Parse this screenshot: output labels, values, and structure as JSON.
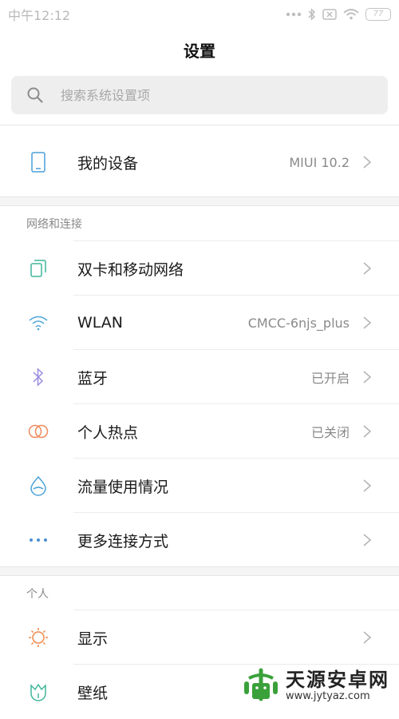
{
  "status_bar": {
    "time": "中午12:12",
    "battery": "77"
  },
  "header": {
    "title": "设置"
  },
  "search": {
    "placeholder": "搜索系统设置项"
  },
  "top_items": [
    {
      "label": "我的设备",
      "value": "MIUI 10.2",
      "icon": "phone-icon"
    }
  ],
  "sections": [
    {
      "title": "网络和连接",
      "items": [
        {
          "label": "双卡和移动网络",
          "value": "",
          "icon": "sim-card-icon"
        },
        {
          "label": "WLAN",
          "value": "CMCC-6njs_plus",
          "icon": "wifi-icon"
        },
        {
          "label": "蓝牙",
          "value": "已开启",
          "icon": "bluetooth-icon"
        },
        {
          "label": "个人热点",
          "value": "已关闭",
          "icon": "hotspot-icon"
        },
        {
          "label": "流量使用情况",
          "value": "",
          "icon": "data-usage-icon"
        },
        {
          "label": "更多连接方式",
          "value": "",
          "icon": "more-dots-icon"
        }
      ]
    },
    {
      "title": "个人",
      "items": [
        {
          "label": "显示",
          "value": "",
          "icon": "brightness-icon"
        },
        {
          "label": "壁纸",
          "value": "",
          "icon": "wallpaper-icon"
        }
      ]
    }
  ],
  "watermark": {
    "title": "天源安卓网",
    "url": "www.jytyaz.com"
  },
  "colors": {
    "device_icon": "#4a9fd6",
    "sim_icon": "#3fb59a",
    "wifi_icon": "#4fa6d8",
    "bluetooth_icon": "#9a8de0",
    "hotspot_icon": "#f08a5d",
    "data_icon": "#4aa3d8",
    "more_icon": "#4a8fd6",
    "display_icon": "#f08a4b",
    "wallpaper_icon": "#3fb59a",
    "watermark_green": "#3aa13a"
  }
}
